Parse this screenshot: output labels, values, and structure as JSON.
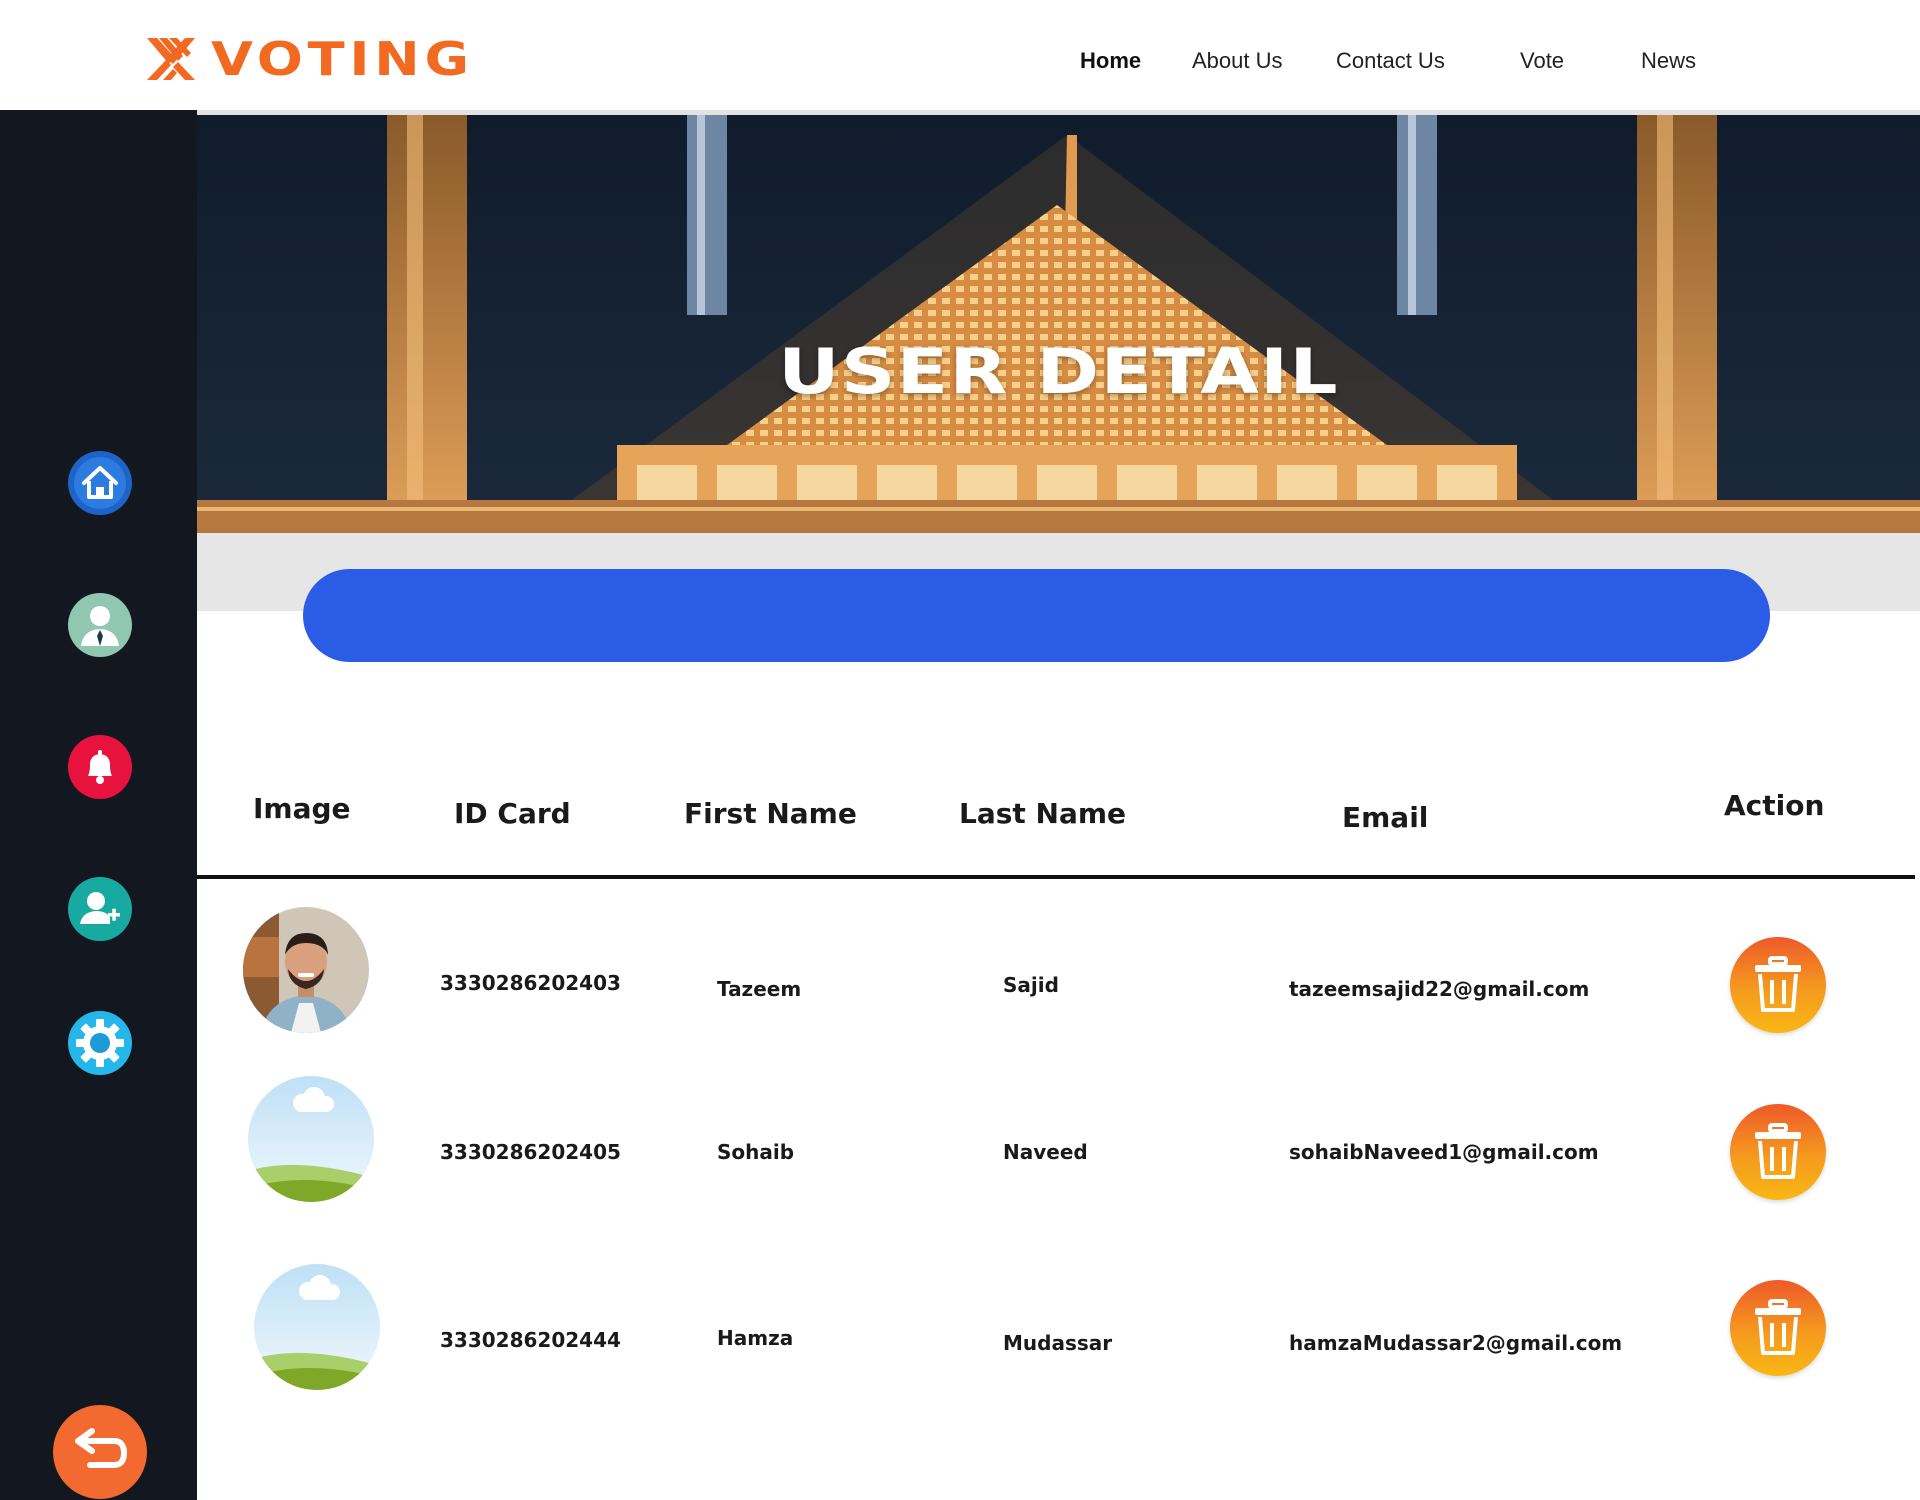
{
  "brand": {
    "name": "VOTING",
    "color": "#f26a21"
  },
  "nav": [
    {
      "label": "Home",
      "active": true
    },
    {
      "label": "About Us",
      "active": false
    },
    {
      "label": "Contact Us",
      "active": false
    },
    {
      "label": "Vote",
      "active": false
    },
    {
      "label": "News",
      "active": false
    }
  ],
  "sidebar": {
    "icons": [
      "home-icon",
      "user-profile-icon",
      "notification-bell-icon",
      "add-user-icon",
      "settings-gear-icon"
    ],
    "back_icon": "back-arrow-icon"
  },
  "banner": {
    "title": "USER DETAIL"
  },
  "search_bar": {
    "color": "#2a5ce6"
  },
  "table": {
    "headers": {
      "image": "Image",
      "id_card": "ID Card",
      "first_name": "First Name",
      "last_name": "Last Name",
      "email": "Email",
      "action": "Action"
    },
    "rows": [
      {
        "avatar": "person-photo",
        "id_card": "3330286202403",
        "first_name": "Tazeem",
        "last_name": "Sajid",
        "email": "tazeemsajid22@gmail.com",
        "action_icon": "trash-icon"
      },
      {
        "avatar": "placeholder-landscape",
        "id_card": "3330286202405",
        "first_name": "Sohaib",
        "last_name": "Naveed",
        "email": "sohaibNaveed1@gmail.com",
        "action_icon": "trash-icon"
      },
      {
        "avatar": "placeholder-landscape",
        "id_card": "3330286202444",
        "first_name": "Hamza",
        "last_name": "Mudassar",
        "email": "hamzaMudassar2@gmail.com",
        "action_icon": "trash-icon"
      }
    ]
  }
}
